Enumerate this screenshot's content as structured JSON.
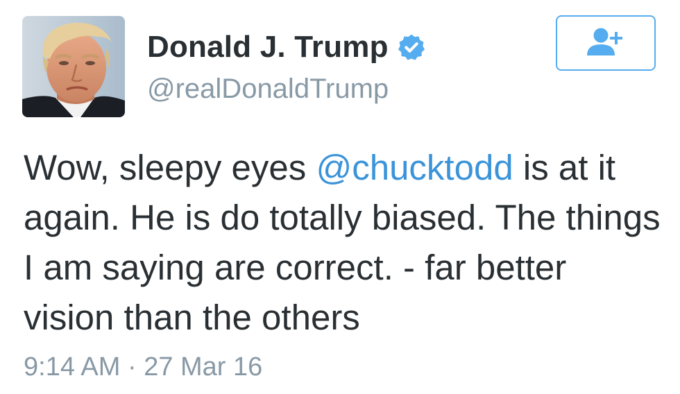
{
  "user": {
    "display_name": "Donald J. Trump",
    "handle": "@realDonaldTrump",
    "verified_icon": "verified-badge-icon",
    "avatar_icon": "profile-avatar"
  },
  "follow_button": {
    "icon": "add-user-icon"
  },
  "tweet": {
    "text_part1": "Wow, sleepy eyes ",
    "mention": "@chucktodd",
    "text_part2": " is at it again. He is do totally biased. The things I am saying are correct. - far better vision than the others",
    "timestamp": "9:14 AM · 27 Mar 16"
  },
  "colors": {
    "accent": "#55acee",
    "mention": "#3b94d9",
    "text": "#292f33",
    "muted": "#8899a6"
  }
}
